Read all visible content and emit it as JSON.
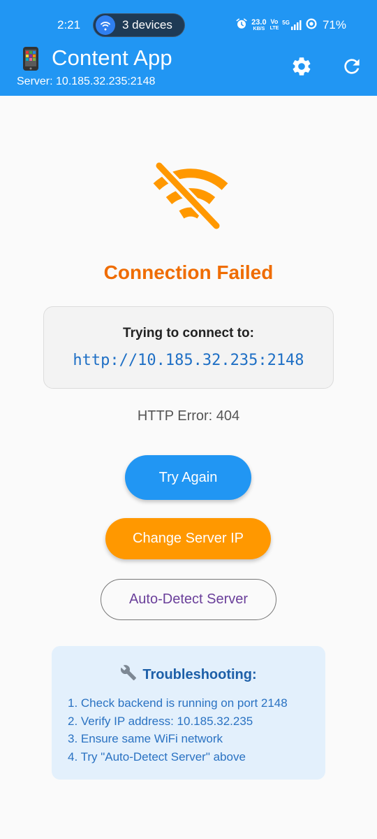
{
  "status_bar": {
    "time": "2:21",
    "devices_label": "3 devices",
    "net_speed_value": "23.0",
    "net_speed_unit": "KB/S",
    "volte_top": "Vo",
    "volte_bottom": "LTE",
    "network": "5G",
    "battery": "71%"
  },
  "app_bar": {
    "title": "Content App",
    "server_line": "Server: 10.185.32.235:2148"
  },
  "error": {
    "title": "Connection Failed",
    "connect_label": "Trying to connect to:",
    "connect_url": "http://10.185.32.235:2148",
    "http_error": "HTTP Error: 404"
  },
  "buttons": {
    "try_again": "Try Again",
    "change_ip": "Change Server IP",
    "auto_detect": "Auto-Detect Server"
  },
  "troubleshooting": {
    "title": "Troubleshooting:",
    "steps": [
      "1. Check backend is running on port 2148",
      "2. Verify IP address: 10.185.32.235",
      "3. Ensure same WiFi network",
      "4. Try \"Auto-Detect Server\" above"
    ]
  },
  "colors": {
    "primary": "#2196f3",
    "accent_orange": "#ff9800",
    "error_title": "#ef6c00",
    "link_blue": "#1e6fc5"
  },
  "icons": [
    "wifi-hotspot-icon",
    "alarm-icon",
    "signal-icon",
    "battery-ring-icon",
    "phone-icon",
    "gear-icon",
    "refresh-icon",
    "wifi-off-icon",
    "wrench-icon"
  ]
}
